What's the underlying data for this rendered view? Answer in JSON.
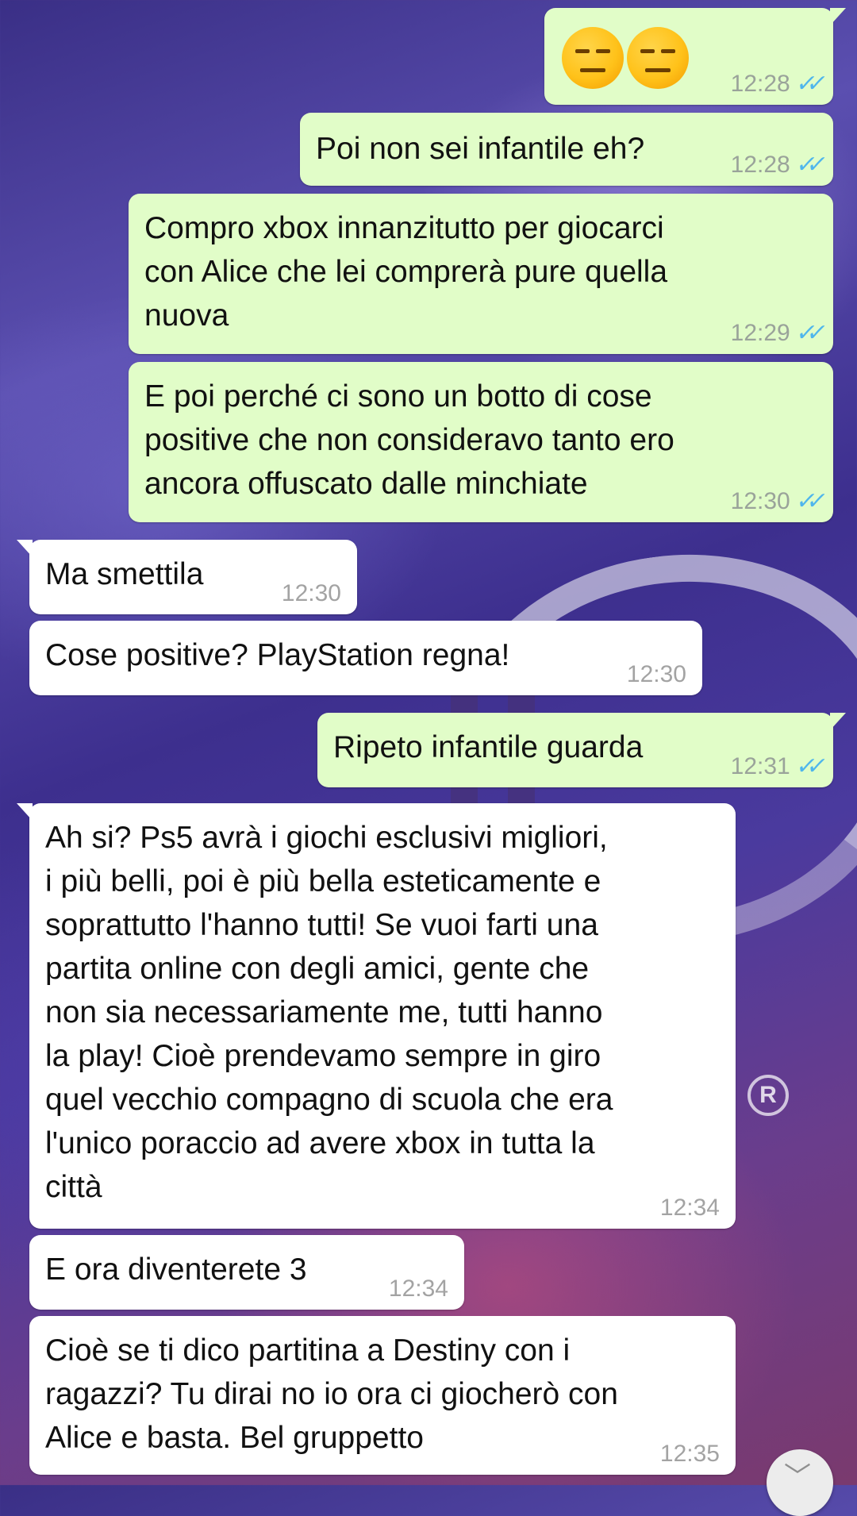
{
  "messages": [
    {
      "kind": "out",
      "emoji": true,
      "time": "12:28",
      "read": "✓✓"
    },
    {
      "kind": "out",
      "text": "Poi non sei infantile eh?",
      "time": "12:28",
      "read": "✓✓"
    },
    {
      "kind": "out",
      "text": "Compro xbox innanzitutto per giocarci\ncon Alice che lei comprerà pure quella\nnuova",
      "time": "12:29",
      "read": "✓✓"
    },
    {
      "kind": "out",
      "text": "E poi perché ci sono un botto di cose\npositive che non consideravo tanto ero\nancora offuscato dalle minchiate",
      "time": "12:30",
      "read": "✓✓"
    },
    {
      "kind": "in",
      "text": "Ma smettila",
      "time": "12:30"
    },
    {
      "kind": "in",
      "text": "Cose positive? PlayStation regna!",
      "time": "12:30"
    },
    {
      "kind": "out",
      "text": "Ripeto infantile guarda",
      "time": "12:31",
      "read": "✓✓"
    },
    {
      "kind": "in",
      "text": "Ah si? Ps5 avrà i giochi esclusivi migliori,\ni più belli, poi è più bella esteticamente e\nsoprattutto l'hanno tutti! Se vuoi farti una\npartita online con degli amici, gente che\nnon sia necessariamente me, tutti hanno\nla play! Cioè prendevamo sempre in giro\nquel vecchio compagno di scuola che era\nl'unico poraccio ad avere xbox in tutta la\ncittà",
      "time": "12:34"
    },
    {
      "kind": "in",
      "text": "E ora diventerete 3",
      "time": "12:34"
    },
    {
      "kind": "in",
      "text": "Cioè se ti dico partitina a Destiny con i\nragazzi? Tu dirai no io ora ci giocherò con\nAlice e basta. Bel gruppetto",
      "time": "12:35"
    }
  ],
  "wallpaper": {
    "registered_mark": "R"
  },
  "icons": {
    "read_receipt": "double-check-icon",
    "scroll_down": "chevron-down-icon",
    "emoji": "expressionless-face-icon"
  },
  "scroll_down_glyph": "﹀",
  "colors": {
    "outgoing_bubble": "#e1fdc8",
    "incoming_bubble": "#ffffff",
    "read_tick": "#4fb6ec"
  }
}
